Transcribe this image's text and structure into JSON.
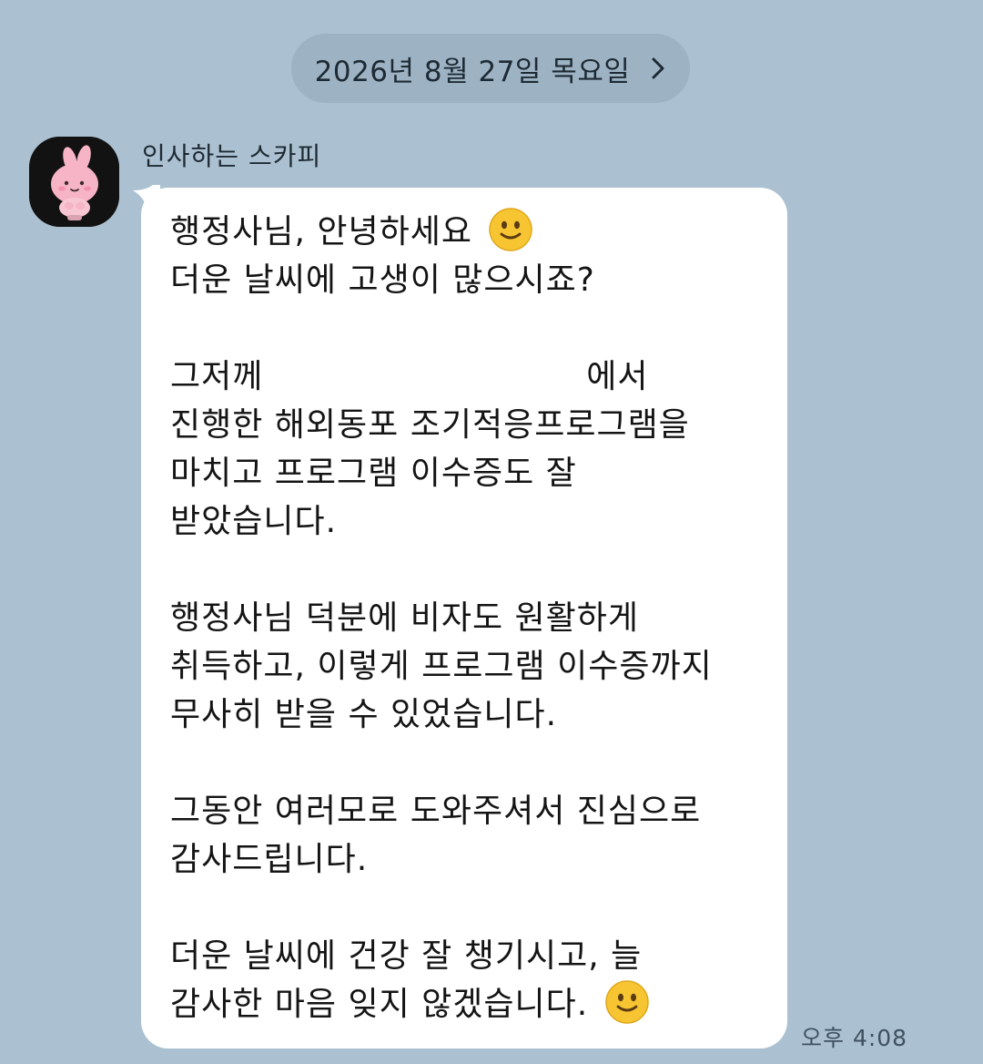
{
  "chat": {
    "date_label": "2026년 8월 27일 목요일",
    "date_icon": "chevron-right-icon",
    "sender": {
      "name": "인사하는 스카피",
      "avatar_icon": "pink-rabbit-avatar-icon"
    },
    "message": {
      "lines": [
        "행정사님, 안녕하세요",
        "더운 날씨에 고생이 많으시죠?",
        "",
        "그저께",
        "에서",
        "진행한 해외동포 조기적응프로그램을",
        "마치고 프로그램 이수증도 잘",
        "받았습니다.",
        "",
        "행정사님 덕분에 비자도 원활하게",
        "취득하고, 이렇게 프로그램 이수증까지",
        "무사히 받을 수 있었습니다.",
        "",
        "그동안 여러모로 도와주셔서 진심으로",
        "감사드립니다.",
        "",
        "더운 날씨에 건강 잘 챙기시고, 늘",
        "감사한 마음 잊지 않겠습니다."
      ],
      "emoji_icon": "slightly-smiling-face-icon",
      "time": "오후 4:08"
    }
  },
  "colors": {
    "background": "#abc1d1",
    "date_pill": "#9db3c4",
    "bubble": "#ffffff",
    "avatar_bg": "#121212",
    "emoji_face": "#f7c531"
  }
}
